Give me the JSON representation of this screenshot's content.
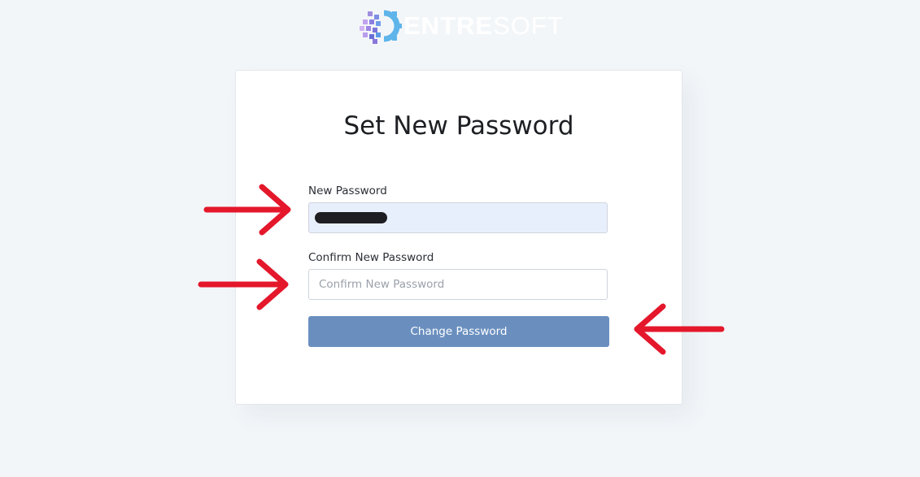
{
  "brand": {
    "name_bold": "ENTRE",
    "name_light": "SOFT",
    "logo_icon": "gear-pixel-logo-icon"
  },
  "form": {
    "title": "Set New Password",
    "new_password_label": "New Password",
    "new_password_value": "••••••••••",
    "confirm_password_label": "Confirm New Password",
    "confirm_password_placeholder": "Confirm New Password",
    "submit_label": "Change Password"
  },
  "annotations": {
    "arrow_color": "#e4172b",
    "arrow_icons": [
      "arrow-right-icon",
      "arrow-right-icon",
      "arrow-left-icon"
    ]
  },
  "colors": {
    "background": "#f3f6f9",
    "button": "#6a8fbf",
    "autofill_input": "#e8effc"
  }
}
